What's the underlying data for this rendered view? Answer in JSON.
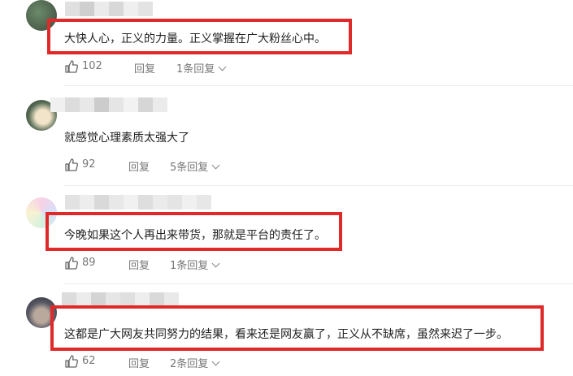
{
  "comments": [
    {
      "text": "大快人心，正义的力量。正义掌握在广大粉丝心中。",
      "likes": "102",
      "reply_label": "回复",
      "replies_label": "1条回复"
    },
    {
      "text": "就感觉心理素质太强大了",
      "likes": "92",
      "reply_label": "回复",
      "replies_label": "5条回复"
    },
    {
      "text": "今晚如果这个人再出来带货，那就是平台的责任了。",
      "likes": "89",
      "reply_label": "回复",
      "replies_label": "1条回复"
    },
    {
      "text": "这都是广大网友共同努力的结果，看来还是网友赢了，正义从不缺席，虽然来迟了一步。",
      "likes": "62",
      "reply_label": "回复",
      "replies_label": "2条回复"
    }
  ],
  "icons": {
    "like": "thumbs-up-icon",
    "expand": "chevron-down-icon"
  },
  "colors": {
    "highlight_box": "#e02a2a",
    "meta_text": "#777777",
    "divider": "#ececec"
  }
}
